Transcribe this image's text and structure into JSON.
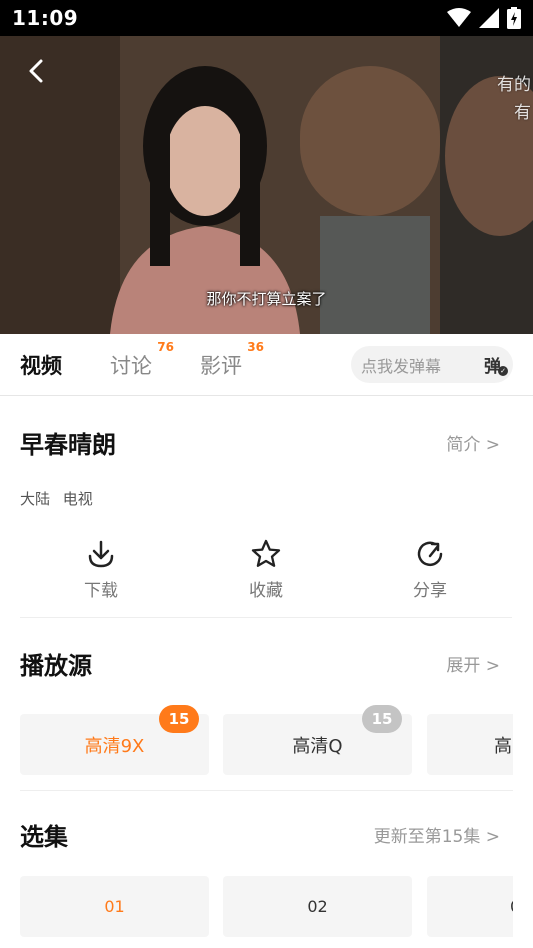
{
  "status_bar": {
    "time": "11:09"
  },
  "video": {
    "subtitle": "那你不打算立案了",
    "danmaku": [
      "有的",
      "有"
    ]
  },
  "tabs": [
    {
      "label": "视频",
      "badge": ""
    },
    {
      "label": "讨论",
      "badge": "76"
    },
    {
      "label": "影评",
      "badge": "36"
    }
  ],
  "danmaku_input": {
    "placeholder": "点我发弹幕",
    "toggle_label": "弹"
  },
  "show": {
    "title": "早春晴朗",
    "intro_link": "简介 >",
    "tags": [
      "大陆",
      "电视"
    ]
  },
  "actions": [
    {
      "label": "下载",
      "icon": "download-icon"
    },
    {
      "label": "收藏",
      "icon": "star-icon"
    },
    {
      "label": "分享",
      "icon": "share-icon"
    }
  ],
  "sources": {
    "title": "播放源",
    "expand_link": "展开 >",
    "items": [
      {
        "label": "高清9X",
        "badge": "15",
        "selected": true
      },
      {
        "label": "高清Q",
        "badge": "15",
        "selected": false
      },
      {
        "label": "高",
        "badge": "",
        "selected": false
      }
    ]
  },
  "episodes": {
    "title": "选集",
    "update_link": "更新至第15集 >",
    "items": [
      "01",
      "02",
      "0"
    ]
  },
  "colors": {
    "accent": "#ff7a1a",
    "badge_grey": "#c4c4c4",
    "chip_bg": "#f5f5f5"
  }
}
